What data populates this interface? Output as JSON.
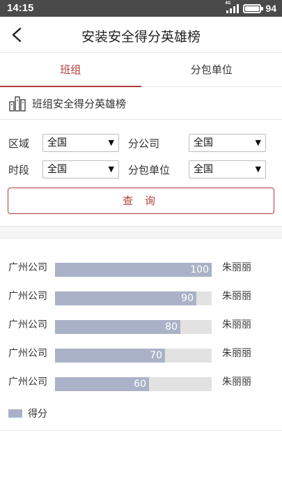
{
  "status": {
    "time": "14:15",
    "network": "4G",
    "battery": "94"
  },
  "nav": {
    "title": "安装安全得分英雄榜"
  },
  "tabs": [
    {
      "label": "班组",
      "active": true
    },
    {
      "label": "分包单位",
      "active": false
    }
  ],
  "section": {
    "title": "班组安全得分英雄榜"
  },
  "filters": {
    "region_label": "区域",
    "region_value": "全国",
    "branch_label": "分公司",
    "branch_value": "全国",
    "period_label": "时段",
    "period_value": "全国",
    "sub_label": "分包单位",
    "sub_value": "全国"
  },
  "query_button": "查 询",
  "colors": {
    "accent": "#b23a3a",
    "bar": "#a9b2c6",
    "track": "#e2e2e2"
  },
  "chart_data": {
    "type": "bar",
    "orientation": "horizontal",
    "categories": [
      "广州公司",
      "广州公司",
      "广州公司",
      "广州公司",
      "广州公司"
    ],
    "values": [
      100,
      90,
      80,
      70,
      60
    ],
    "right_labels": [
      "朱丽丽",
      "朱丽丽",
      "朱丽丽",
      "朱丽丽",
      "朱丽丽"
    ],
    "xlim": [
      0,
      100
    ],
    "series": [
      {
        "name": "得分",
        "values": [
          100,
          90,
          80,
          70,
          60
        ]
      }
    ],
    "legend": "bottom-left"
  }
}
